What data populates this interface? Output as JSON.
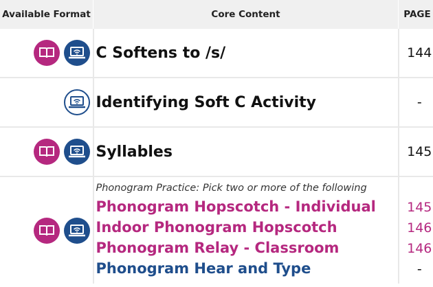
{
  "header": {
    "format": "Available Format",
    "core": "Core Content",
    "page": "PAGE"
  },
  "rows": [
    {
      "icons": [
        "book-icon",
        "laptop-icon"
      ],
      "title": "C Softens to /s/",
      "page": "144"
    },
    {
      "icons": [
        "laptop-icon"
      ],
      "title": "Identifying Soft C Activity",
      "page": "-"
    },
    {
      "icons": [
        "book-icon",
        "laptop-icon"
      ],
      "title": "Syllables",
      "page": "145"
    },
    {
      "icons": [
        "book-icon",
        "laptop-icon"
      ],
      "intro": "Phonogram Practice: Pick two or more of the following",
      "activities": [
        {
          "label": "Phonogram Hopscotch - Individual",
          "page": "145"
        },
        {
          "label": "Indoor Phonogram Hopscotch",
          "page": "146"
        },
        {
          "label": "Phonogram Relay - Classroom",
          "page": "146"
        },
        {
          "label": "Phonogram Hear and Type",
          "page": "-"
        }
      ]
    }
  ],
  "colors": {
    "magenta": "#b5287f",
    "navy": "#1f4e8c",
    "header_bg": "#f0f0f0"
  }
}
